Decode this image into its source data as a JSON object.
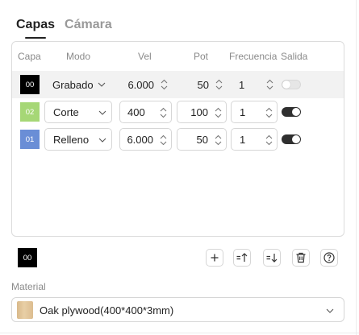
{
  "tabs": [
    {
      "label": "Capas",
      "active": true
    },
    {
      "label": "Cámara",
      "active": false
    }
  ],
  "table": {
    "headers": {
      "layer": "Capa",
      "mode": "Modo",
      "speed": "Vel",
      "power": "Pot",
      "frequency": "Frecuencia",
      "output": "Salida"
    },
    "rows": [
      {
        "layer": "00",
        "color": "#000000",
        "mode": "Grabado",
        "speed": "6.000",
        "power": "50",
        "frequency": "1",
        "output": false,
        "selected": true
      },
      {
        "layer": "02",
        "color": "#a6d776",
        "mode": "Corte",
        "speed": "400",
        "power": "100",
        "frequency": "1",
        "output": true,
        "selected": false
      },
      {
        "layer": "01",
        "color": "#6a8ed6",
        "mode": "Relleno",
        "speed": "6.000",
        "power": "50",
        "frequency": "1",
        "output": true,
        "selected": false
      }
    ]
  },
  "current_layer": {
    "label": "00",
    "color": "#000000"
  },
  "toolbar": {
    "icons": [
      "add-icon",
      "move-layer-up-icon",
      "move-layer-down-icon",
      "delete-icon",
      "help-icon"
    ]
  },
  "material": {
    "label": "Material",
    "value": "Oak plywood(400*400*3mm)"
  }
}
